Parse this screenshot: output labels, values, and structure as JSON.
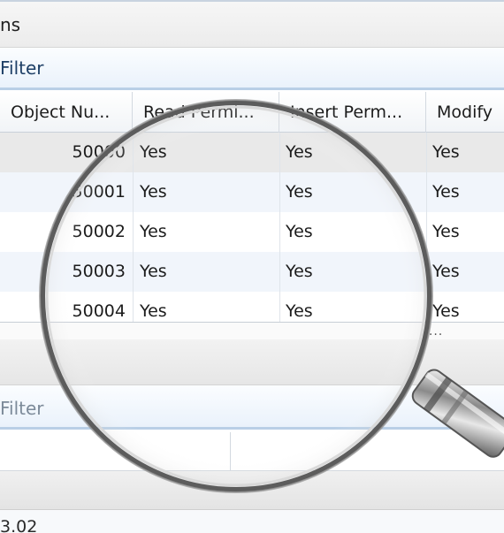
{
  "window": {
    "title": "ns"
  },
  "filter": {
    "label": "Filter"
  },
  "grid": {
    "columns": [
      {
        "label": "Object Nu..."
      },
      {
        "label": "Read Permi..."
      },
      {
        "label": "Insert Perm..."
      },
      {
        "label": "Modify"
      }
    ],
    "rows": [
      {
        "object": "50000",
        "read": "Yes",
        "insert": "Yes",
        "modify": "Yes"
      },
      {
        "object": "50001",
        "read": "Yes",
        "insert": "Yes",
        "modify": "Yes"
      },
      {
        "object": "50002",
        "read": "Yes",
        "insert": "Yes",
        "modify": "Yes"
      },
      {
        "object": "50003",
        "read": "Yes",
        "insert": "Yes",
        "modify": "Yes"
      },
      {
        "object": "50004",
        "read": "Yes",
        "insert": "Yes",
        "modify": "Yes"
      }
    ],
    "more": "....."
  },
  "filter2": {
    "label": "Filter"
  },
  "status": {
    "text": "3.02"
  },
  "icons": {
    "magnifier": "magnifying-glass-icon"
  },
  "colors": {
    "filter_text": "#1e3f66",
    "selected_row": "#e9e9e9",
    "alt_row": "#f1f5fb"
  }
}
